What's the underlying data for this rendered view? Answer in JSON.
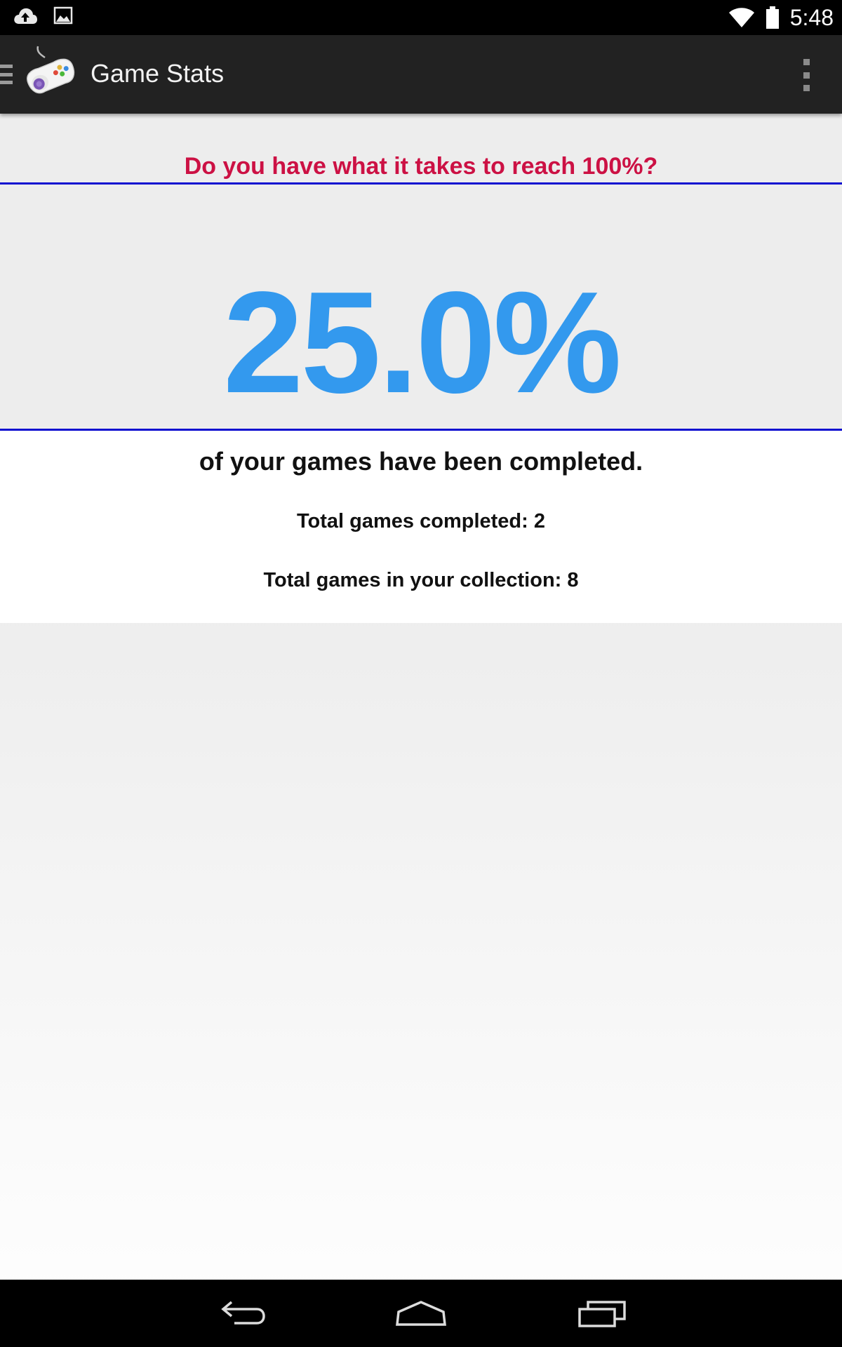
{
  "status_bar": {
    "time": "5:48",
    "icons": [
      "upload-cloud-icon",
      "image-icon",
      "wifi-icon",
      "battery-icon"
    ]
  },
  "action_bar": {
    "title": "Game Stats",
    "logo_icon": "game-controller-icon",
    "menu_icon": "overflow-menu-icon"
  },
  "stats": {
    "tagline": "Do you have what it takes to reach 100%?",
    "percent_completed": "25.0%",
    "completed_caption": "of your games have been completed.",
    "total_completed_label": "Total games completed: 2",
    "total_collection_label": "Total games in your collection: 8"
  },
  "nav_bar": {
    "icons": [
      "back-icon",
      "home-icon",
      "recent-apps-icon"
    ]
  },
  "colors": {
    "tagline": "#cc1144",
    "percent": "#3399ee",
    "rule": "#1010d0",
    "action_bar": "#222222"
  }
}
